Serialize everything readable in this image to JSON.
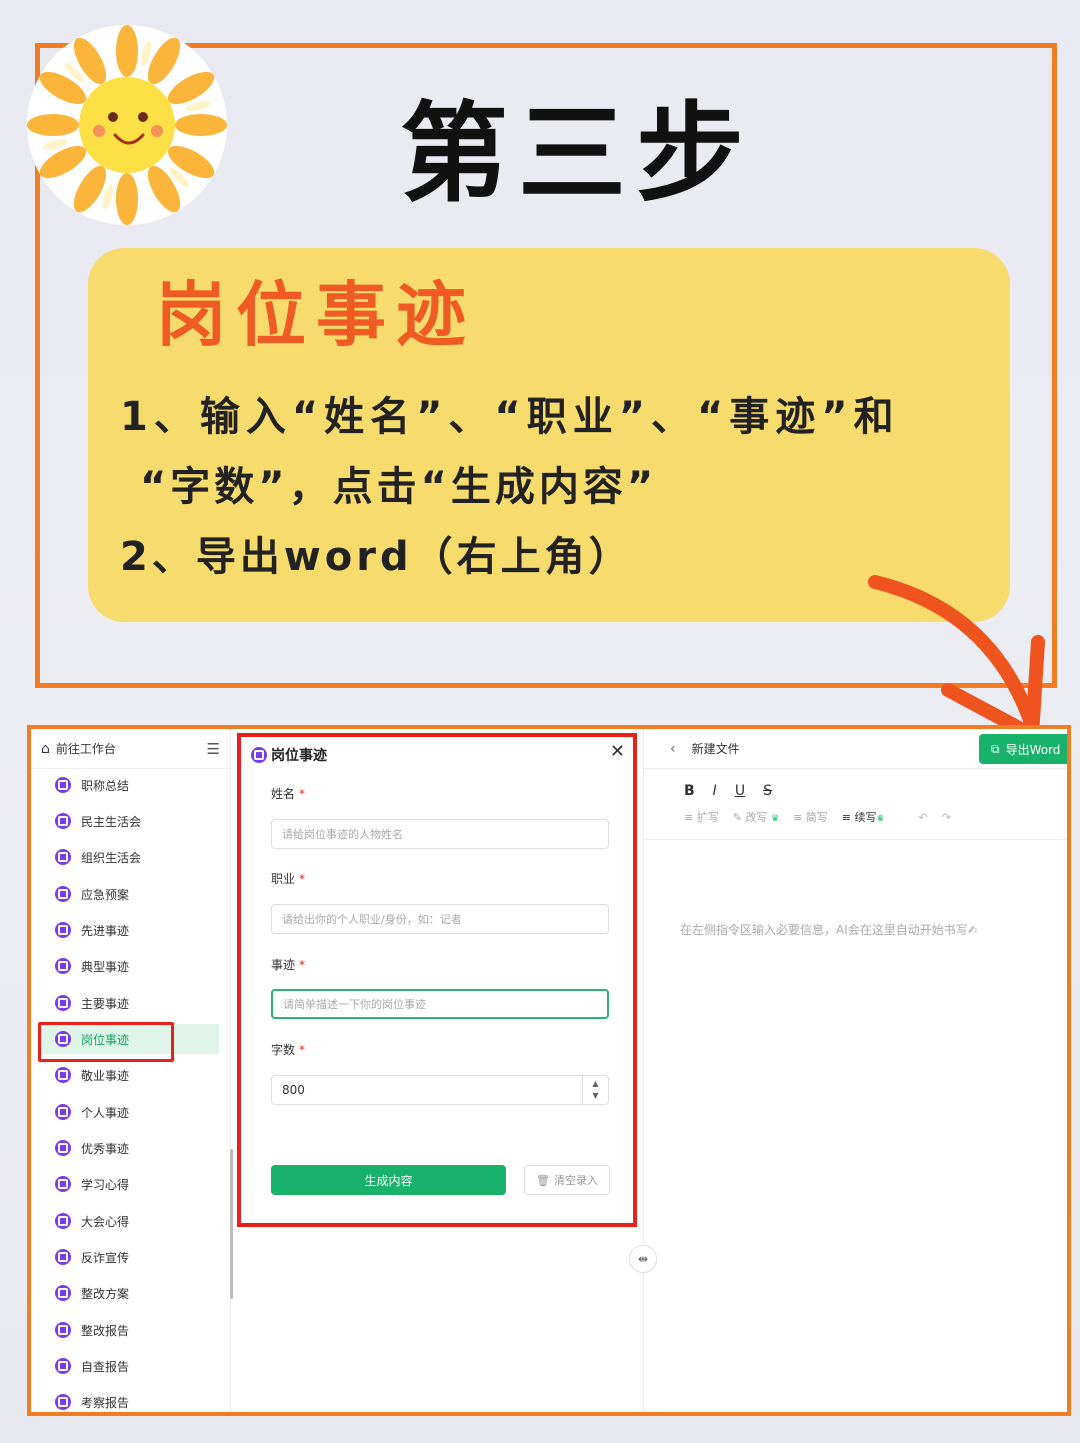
{
  "header": {
    "title": "第三步",
    "subtitle": "岗位事迹",
    "step1_line1": "1、输入“姓名”、“职业”、“事迹”和",
    "step1_line2": "“字数”，点击“生成内容”",
    "step2": "2、导出word（右上角）"
  },
  "colors": {
    "frame": "#f07c23",
    "yellow": "#f7db6d",
    "subtitle": "#f05a23",
    "accent_green": "#19b26b",
    "highlight_red": "#e8221b"
  },
  "sidebar": {
    "header_label": "前往工作台",
    "items": [
      {
        "label": "职称总结"
      },
      {
        "label": "民主生活会"
      },
      {
        "label": "组织生活会"
      },
      {
        "label": "应急预案"
      },
      {
        "label": "先进事迹"
      },
      {
        "label": "典型事迹"
      },
      {
        "label": "主要事迹"
      },
      {
        "label": "岗位事迹",
        "active": true
      },
      {
        "label": "敬业事迹"
      },
      {
        "label": "个人事迹"
      },
      {
        "label": "优秀事迹"
      },
      {
        "label": "学习心得"
      },
      {
        "label": "大会心得"
      },
      {
        "label": "反诈宣传"
      },
      {
        "label": "整改方案"
      },
      {
        "label": "整改报告"
      },
      {
        "label": "自查报告"
      },
      {
        "label": "考察报告"
      }
    ]
  },
  "form": {
    "title": "岗位事迹",
    "name_label": "姓名",
    "name_placeholder": "请给岗位事迹的人物姓名",
    "job_label": "职业",
    "job_placeholder": "请给出你的个人职业/身份，如：记者",
    "deeds_label": "事迹",
    "deeds_placeholder": "请简单描述一下你的岗位事迹",
    "count_label": "字数",
    "count_value": "800",
    "required_mark": "*",
    "generate_button": "生成内容",
    "clear_button": "清空录入"
  },
  "editor": {
    "doc_title": "新建文件",
    "export_button": "导出Word",
    "format_bold": "B",
    "format_italic": "I",
    "format_underline": "U",
    "format_strike": "S",
    "tool_expand": "扩写",
    "tool_rewrite": "改写",
    "tool_simplify": "简写",
    "tool_continue": "续写",
    "hint": "在左侧指令区输入必要信息，AI会在这里自动开始书写✍"
  }
}
